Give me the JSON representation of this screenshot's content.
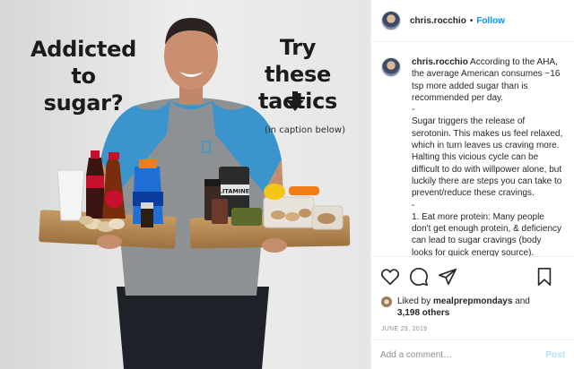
{
  "photo": {
    "headline_left": [
      "Addicted to",
      "sugar?"
    ],
    "headline_right": [
      "Try these",
      "tactics"
    ],
    "caption_note": "(in caption below)",
    "label_on_tub": "LITAMINE"
  },
  "post": {
    "username": "chris.rocchio",
    "separator": "•",
    "follow_label": "Follow",
    "caption_paragraphs": [
      "According to the AHA, the average American consumes ~16 tsp more added sugar than is recommended per day.",
      "-",
      "Sugar triggers the release of serotonin. This makes us feel relaxed, which in turn leaves us craving more. Halting this vicious cycle can be difficult to do with willpower alone, but luckily there are steps you can take to prevent/reduce these cravings.",
      "-",
      "1. Eat more protein: Many people don't get enough protein, & deficiency can lead to sugar cravings (body looks for quick energy source). Several studie showed greater weight loss, fat mass loss, & preservation of lean mass after"
    ],
    "liked_by_prefix": "Liked by",
    "liked_by_user": "mealprepmondays",
    "liked_by_and": "and",
    "others": "3,198 others",
    "date": "JUNE 29, 2019",
    "comment_placeholder": "Add a comment…",
    "post_label": "Post"
  },
  "icons": {
    "like": "heart-icon",
    "comment": "comment-icon",
    "share": "share-icon",
    "save": "bookmark-icon"
  },
  "colors": {
    "accent": "#0095f6",
    "post_disabled": "#b2dffc",
    "shirt_blue": "#3b94cc",
    "shirt_gray": "#8e9193"
  }
}
